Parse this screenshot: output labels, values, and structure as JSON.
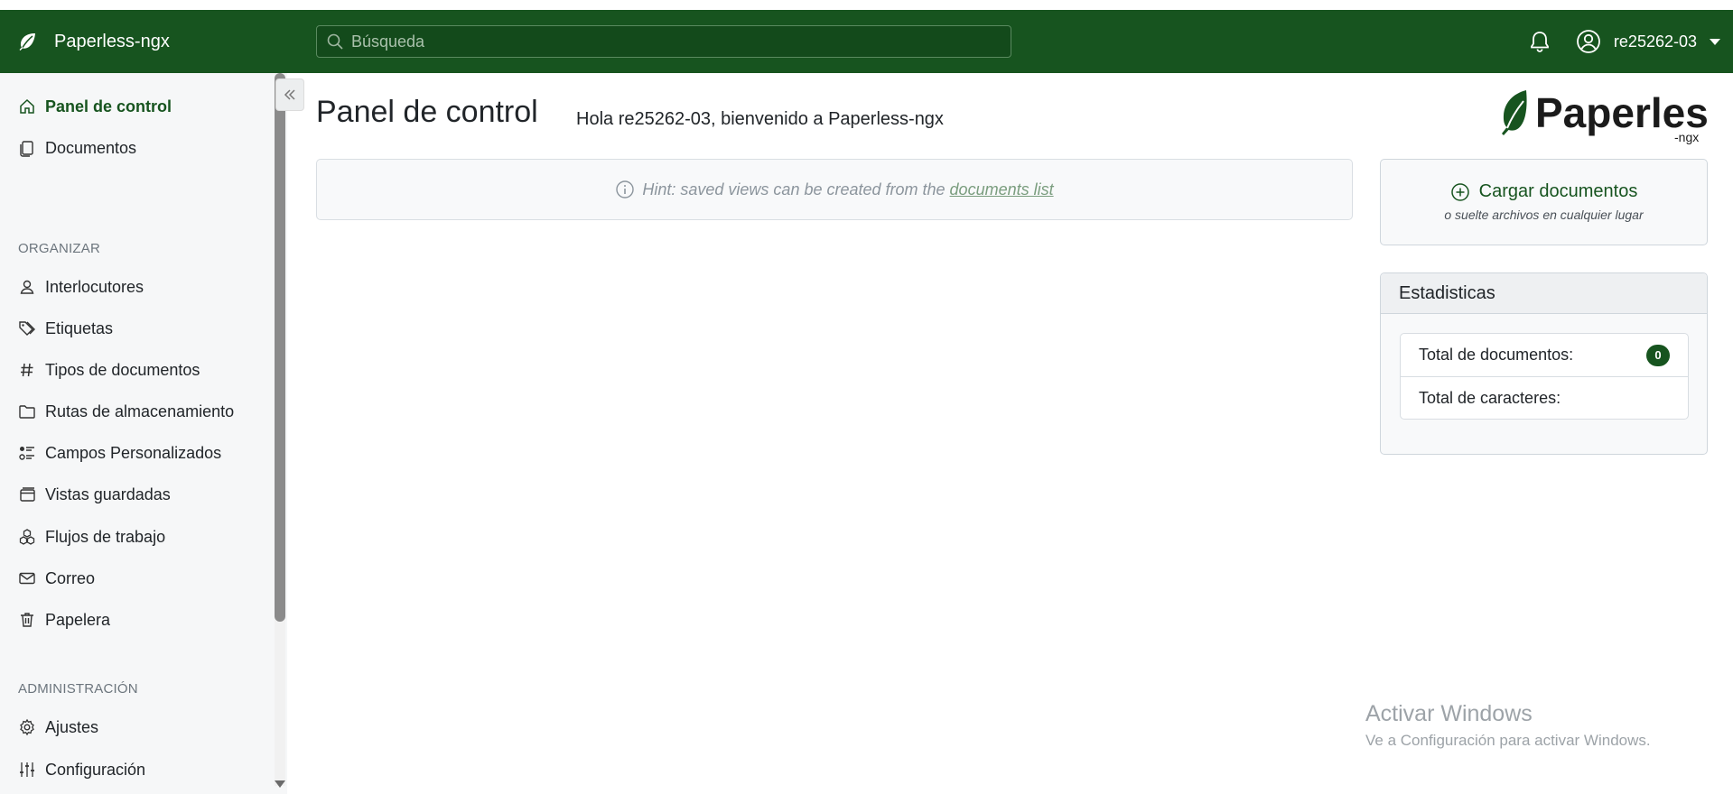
{
  "app": {
    "brand": "Paperless-ngx"
  },
  "header": {
    "search_placeholder": "Búsqueda",
    "user_name": "re25262-03"
  },
  "sidebar": {
    "items_top": [
      {
        "label": "Panel de control",
        "icon": "house-icon",
        "active": true
      },
      {
        "label": "Documentos",
        "icon": "files-icon"
      }
    ],
    "section_organize": "ORGANIZAR",
    "items_organize": [
      {
        "label": "Interlocutores",
        "icon": "person-icon"
      },
      {
        "label": "Etiquetas",
        "icon": "tags-icon"
      },
      {
        "label": "Tipos de documentos",
        "icon": "hash-icon"
      },
      {
        "label": "Rutas de almacenamiento",
        "icon": "folder-icon"
      },
      {
        "label": "Campos Personalizados",
        "icon": "ui-radios-icon"
      },
      {
        "label": "Vistas guardadas",
        "icon": "window-stack-icon"
      },
      {
        "label": "Flujos de trabajo",
        "icon": "boxes-icon"
      },
      {
        "label": "Correo",
        "icon": "envelope-icon"
      },
      {
        "label": "Papelera",
        "icon": "trash-icon"
      }
    ],
    "section_admin": "ADMINISTRACIÓN",
    "items_admin": [
      {
        "label": "Ajustes",
        "icon": "gear-icon"
      },
      {
        "label": "Configuración",
        "icon": "sliders-icon"
      }
    ]
  },
  "main": {
    "title": "Panel de control",
    "greeting": "Hola re25262-03, bienvenido a Paperless-ngx",
    "hint_text": "Hint: saved views can be created from the",
    "hint_link": "documents list"
  },
  "upload": {
    "label": "Cargar documentos",
    "sublabel": "o suelte archivos en cualquier lugar"
  },
  "stats": {
    "title": "Estadisticas",
    "total_docs_label": "Total de documentos:",
    "total_docs_value": "0",
    "total_chars_label": "Total de caracteres:"
  },
  "logo": {
    "main": "Paperless",
    "sub": "-ngx"
  },
  "watermark": {
    "title": "Activar Windows",
    "subtitle": "Ve a Configuración para activar Windows."
  },
  "colors": {
    "primary": "#17541f",
    "sidebar_bg": "#f6f7f8"
  }
}
